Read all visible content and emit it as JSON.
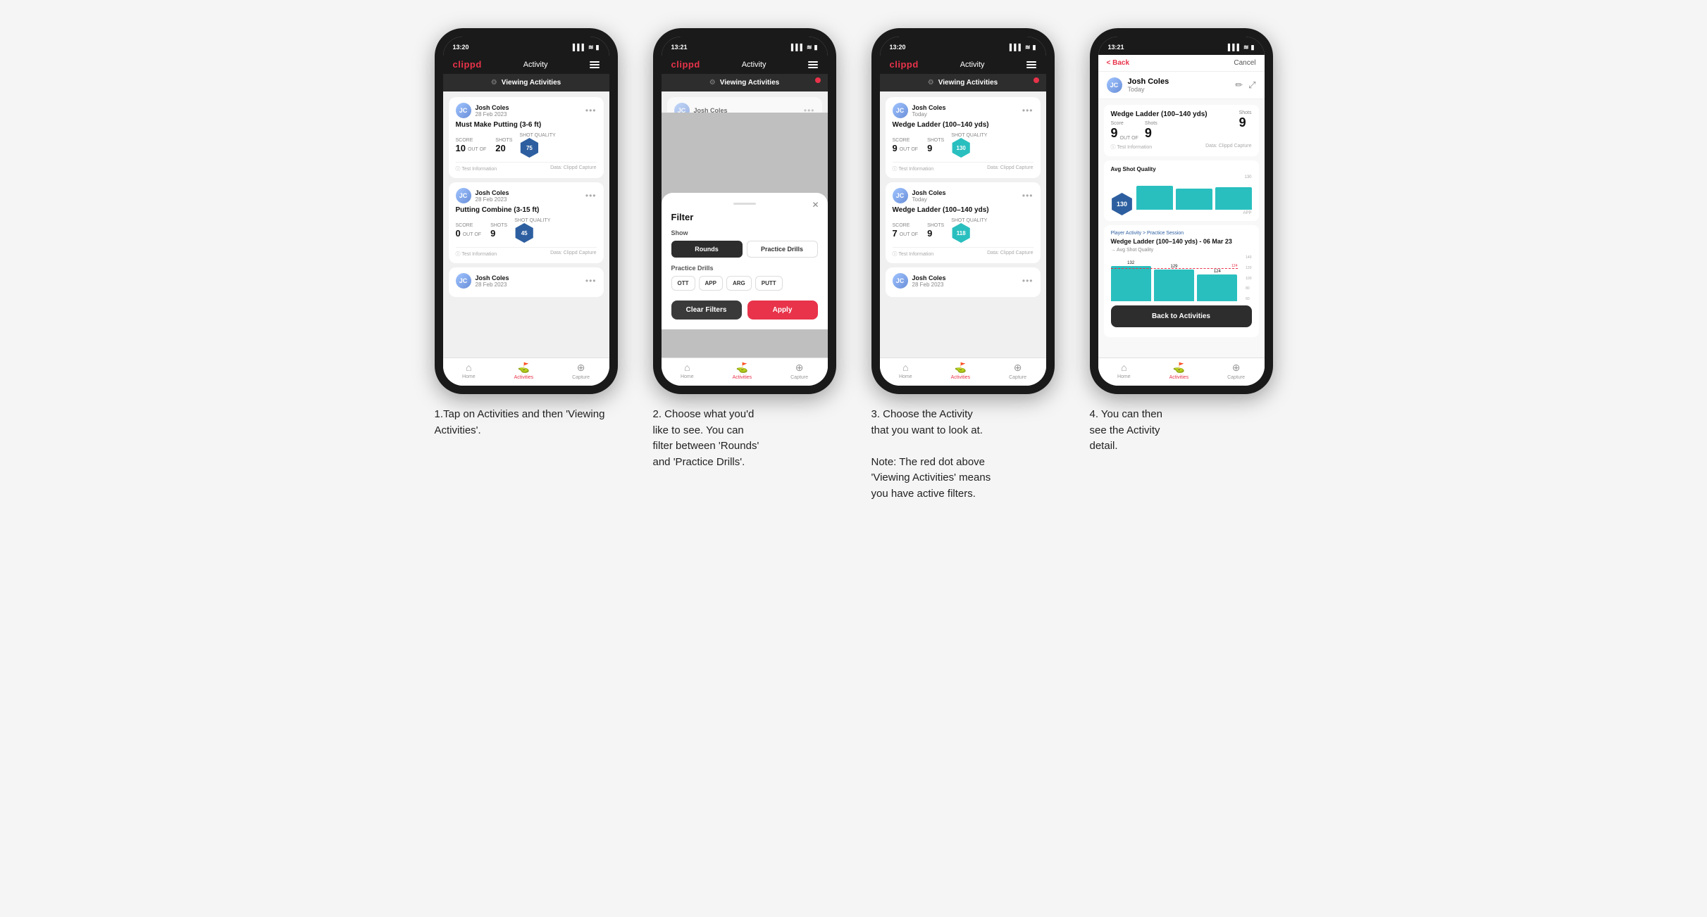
{
  "app": {
    "logo": "clippd",
    "nav_title": "Activity",
    "status_time_1": "13:20",
    "status_time_2": "13:21",
    "status_time_3": "13:20",
    "status_time_4": "13:21"
  },
  "screen1": {
    "banner_text": "Viewing Activities",
    "card1": {
      "user_name": "Josh Coles",
      "user_date": "28 Feb 2023",
      "title": "Must Make Putting (3-6 ft)",
      "score_label": "Score",
      "shots_label": "Shots",
      "quality_label": "Shot Quality",
      "score": "10",
      "out_of": "OUT OF",
      "shots": "20",
      "quality": "75",
      "footer_left": "ⓘ Test Information",
      "footer_right": "Data: Clippd Capture"
    },
    "card2": {
      "user_name": "Josh Coles",
      "user_date": "28 Feb 2023",
      "title": "Putting Combine (3-15 ft)",
      "score": "0",
      "out_of": "OUT OF",
      "shots": "9",
      "quality": "45",
      "footer_left": "ⓘ Test Information",
      "footer_right": "Data: Clippd Capture"
    },
    "card3_user": "Josh Coles",
    "card3_date": "28 Feb 2023",
    "tab_home": "Home",
    "tab_activities": "Activities",
    "tab_capture": "Capture"
  },
  "screen2": {
    "banner_text": "Viewing Activities",
    "partial_user": "Josh Coles",
    "filter_title": "Filter",
    "show_label": "Show",
    "rounds_btn": "Rounds",
    "practice_drills_btn": "Practice Drills",
    "practice_section": "Practice Drills",
    "drill_ott": "OTT",
    "drill_app": "APP",
    "drill_arg": "ARG",
    "drill_putt": "PUTT",
    "clear_filters_btn": "Clear Filters",
    "apply_btn": "Apply",
    "tab_home": "Home",
    "tab_activities": "Activities",
    "tab_capture": "Capture"
  },
  "screen3": {
    "banner_text": "Viewing Activities",
    "card1": {
      "user_name": "Josh Coles",
      "user_date": "Today",
      "title": "Wedge Ladder (100–140 yds)",
      "score_label": "Score",
      "shots_label": "Shots",
      "quality_label": "Shot Quality",
      "score": "9",
      "out_of": "OUT OF",
      "shots": "9",
      "quality": "130",
      "footer_left": "ⓘ Test Information",
      "footer_right": "Data: Clippd Capture"
    },
    "card2": {
      "user_name": "Josh Coles",
      "user_date": "Today",
      "title": "Wedge Ladder (100–140 yds)",
      "score": "7",
      "out_of": "OUT OF",
      "shots": "9",
      "quality": "118",
      "footer_left": "ⓘ Test Information",
      "footer_right": "Data: Clippd Capture"
    },
    "card3_user": "Josh Coles",
    "card3_date": "28 Feb 2023",
    "tab_home": "Home",
    "tab_activities": "Activities",
    "tab_capture": "Capture"
  },
  "screen4": {
    "back_btn": "< Back",
    "cancel_btn": "Cancel",
    "user_name": "Josh Coles",
    "user_date": "Today",
    "card_title": "Wedge Ladder (100–140 yds)",
    "score_label": "Score",
    "shots_label": "Shots",
    "score": "9",
    "out_of": "OUT OF",
    "shots": "9",
    "quality": "9",
    "info_label": "ⓘ Test Information",
    "capture_label": "Data: Clippd Capture",
    "avg_quality_label": "Avg Shot Quality",
    "avg_value": "130",
    "app_label": "APP",
    "player_activity_prefix": "Player Activity > ",
    "player_activity_link": "Practice Session",
    "drill_title": "Wedge Ladder (100–140 yds) - 06 Mar 23",
    "avg_sub": "→ Avg Shot Quality",
    "bar_values": [
      132,
      129,
      124
    ],
    "dashed_val": "124",
    "y_labels": [
      "140",
      "120",
      "100",
      "80",
      "60"
    ],
    "back_to_activities": "Back to Activities",
    "tab_home": "Home",
    "tab_activities": "Activities",
    "tab_capture": "Capture"
  },
  "descriptions": {
    "step1": "1.Tap on Activities and then 'Viewing Activities'.",
    "step2_line1": "2. Choose what you'd",
    "step2_line2": "like to see. You can",
    "step2_line3": "filter between 'Rounds'",
    "step2_line4": "and 'Practice Drills'.",
    "step3_line1": "3. Choose the Activity",
    "step3_line2": "that you want to look at.",
    "step3_note_line1": "Note: The red dot above",
    "step3_note_line2": "'Viewing Activities' means",
    "step3_note_line3": "you have active filters.",
    "step4_line1": "4. You can then",
    "step4_line2": "see the Activity",
    "step4_line3": "detail."
  }
}
